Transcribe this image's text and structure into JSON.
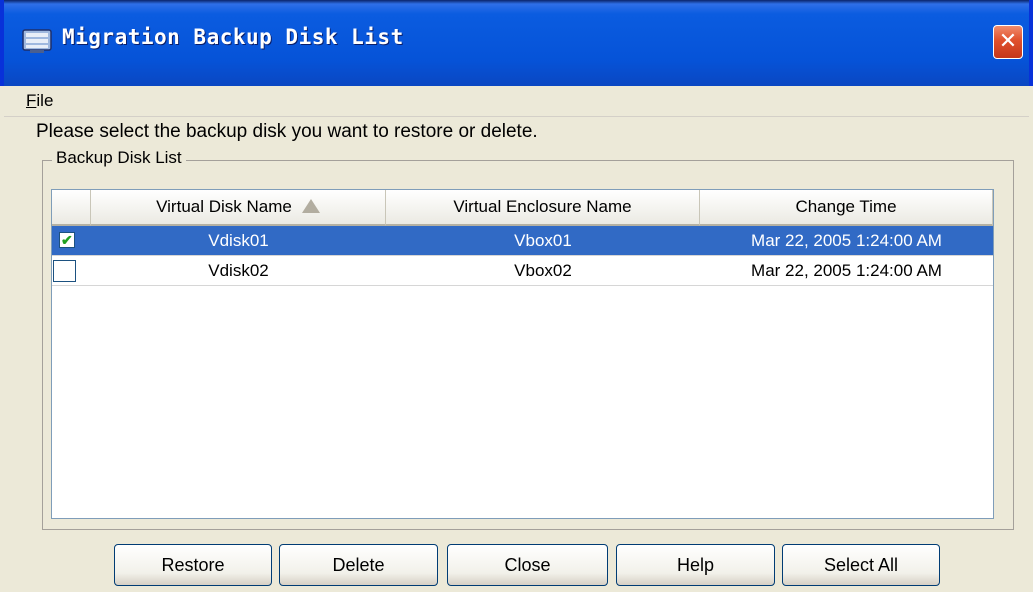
{
  "window": {
    "title": "Migration Backup Disk List",
    "close_glyph": "✕"
  },
  "menu": {
    "file_mnemonic": "F",
    "file_rest": "ile"
  },
  "instruction": "Please select the backup disk you want to restore or delete.",
  "group_title": "Backup Disk List",
  "table": {
    "columns": [
      "Virtual Disk Name",
      "Virtual Enclosure Name",
      "Change Time"
    ],
    "sort_column": "Virtual Disk Name",
    "sort_direction": "ascending",
    "rows": [
      {
        "checked": true,
        "selected": true,
        "disk": "Vdisk01",
        "enclosure": "Vbox01",
        "time": "Mar 22, 2005 1:24:00 AM"
      },
      {
        "checked": false,
        "selected": false,
        "disk": "Vdisk02",
        "enclosure": "Vbox02",
        "time": "Mar 22, 2005 1:24:00 AM"
      }
    ]
  },
  "buttons": {
    "restore": "Restore",
    "delete": "Delete",
    "close": "Close",
    "help": "Help",
    "select_all": "Select All"
  },
  "colors": {
    "selection": "#316ac5",
    "title_bar": "#0653d8",
    "checkmark": "#21a121"
  }
}
